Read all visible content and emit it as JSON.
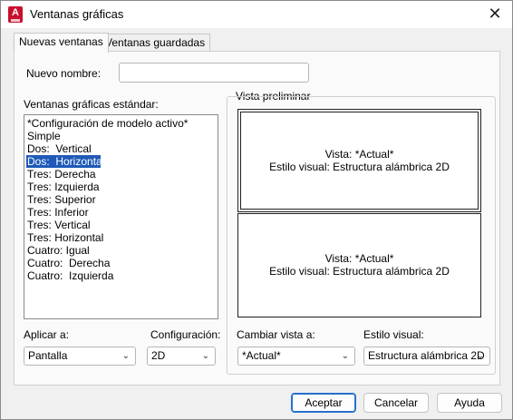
{
  "window": {
    "title": "Ventanas gráficas",
    "app_icon": "autocad-logo",
    "close_icon": "close-icon"
  },
  "tabs": [
    {
      "label": "Nuevas ventanas",
      "active": true
    },
    {
      "label": "Ventanas guardadas",
      "active": false
    }
  ],
  "new_name": {
    "label": "Nuevo nombre:",
    "value": ""
  },
  "standard": {
    "label": "Ventanas gráficas estándar:",
    "items": [
      "*Configuración de modelo activo*",
      "Simple",
      "Dos:  Vertical",
      "Dos:  Horizontal",
      "Tres: Derecha",
      "Tres: Izquierda",
      "Tres: Superior",
      "Tres: Inferior",
      "Tres: Vertical",
      "Tres: Horizontal",
      "Cuatro: Igual",
      "Cuatro:  Derecha",
      "Cuatro:  Izquierda"
    ],
    "selected_index": 3
  },
  "preview": {
    "label": "Vista preliminar",
    "panes": [
      {
        "view": "Vista: *Actual*",
        "style": "Estilo visual: Estructura alámbrica 2D"
      },
      {
        "view": "Vista: *Actual*",
        "style": "Estilo visual: Estructura alámbrica 2D"
      }
    ]
  },
  "apply_to": {
    "label": "Aplicar a:",
    "value": "Pantalla"
  },
  "setup": {
    "label": "Configuración:",
    "value": "2D"
  },
  "change_view": {
    "label": "Cambiar vista a:",
    "value": "*Actual*"
  },
  "visual_style": {
    "label": "Estilo visual:",
    "value": "Estructura alámbrica 2D"
  },
  "buttons": {
    "ok": "Aceptar",
    "cancel": "Cancelar",
    "help": "Ayuda"
  },
  "colors": {
    "selection": "#1f5ab8",
    "primary_border": "#2670cc",
    "app_icon": "#c8102e"
  }
}
